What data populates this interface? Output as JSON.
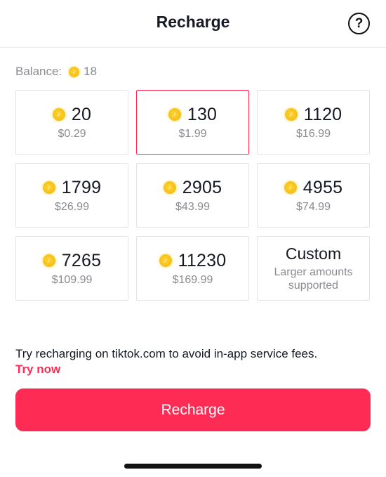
{
  "header": {
    "title": "Recharge",
    "help_icon": "question-circle-icon"
  },
  "balance": {
    "label": "Balance:",
    "coin_icon": "coin-icon",
    "value": "18"
  },
  "packages": [
    {
      "coins": "20",
      "price": "$0.29",
      "selected": false
    },
    {
      "coins": "130",
      "price": "$1.99",
      "selected": true
    },
    {
      "coins": "1120",
      "price": "$16.99",
      "selected": false
    },
    {
      "coins": "1799",
      "price": "$26.99",
      "selected": false
    },
    {
      "coins": "2905",
      "price": "$43.99",
      "selected": false
    },
    {
      "coins": "4955",
      "price": "$74.99",
      "selected": false
    },
    {
      "coins": "7265",
      "price": "$109.99",
      "selected": false
    },
    {
      "coins": "11230",
      "price": "$169.99",
      "selected": false
    }
  ],
  "custom": {
    "title": "Custom",
    "subtitle_line1": "Larger amounts",
    "subtitle_line2": "supported"
  },
  "promo": {
    "text": "Try recharging on tiktok.com to avoid in-app service fees.",
    "link": "Try now"
  },
  "recharge_button": {
    "label": "Recharge"
  },
  "colors": {
    "accent": "#fe2c55",
    "coin": "#f6c21b",
    "muted_text": "#8a8b91",
    "text": "#161823"
  }
}
